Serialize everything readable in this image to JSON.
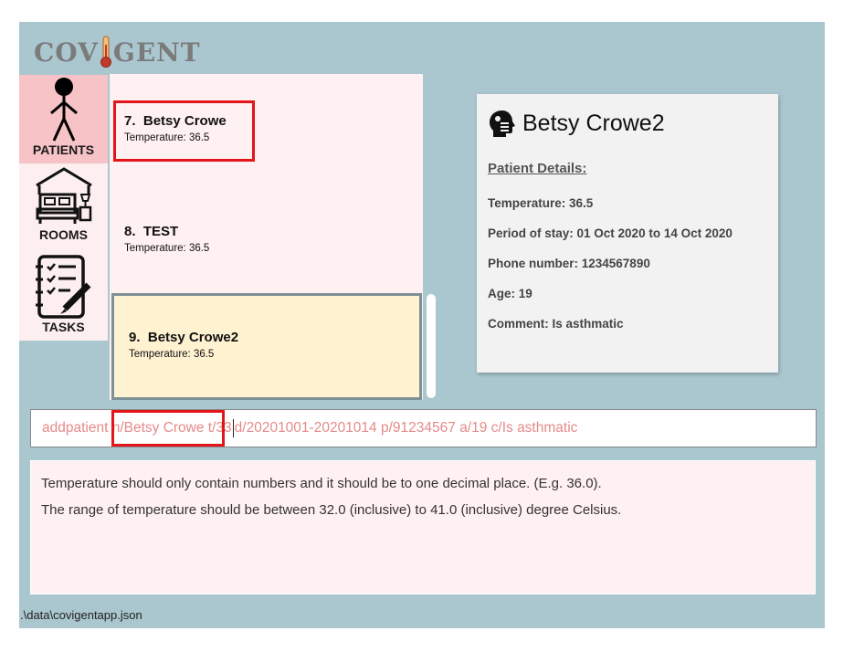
{
  "app": {
    "logo_text_left": "COV",
    "logo_text_right": "GENT"
  },
  "nav": [
    {
      "label": "PATIENTS",
      "icon": "person-icon",
      "active": true
    },
    {
      "label": "ROOMS",
      "icon": "bed-room-icon",
      "active": false
    },
    {
      "label": "TASKS",
      "icon": "checklist-icon",
      "active": false
    }
  ],
  "patients": [
    {
      "index": "7.",
      "name": "Betsy Crowe",
      "temperature": "Temperature: 36.5"
    },
    {
      "index": "8.",
      "name": "TEST",
      "temperature": "Temperature: 36.5"
    },
    {
      "index": "9.",
      "name": "Betsy Crowe2",
      "temperature": "Temperature: 36.5",
      "selected": true
    }
  ],
  "detail": {
    "name": "Betsy Crowe2",
    "icon": "patient-head-icon",
    "section": "Patient Details:",
    "temperature": "Temperature: 36.5",
    "period": "Period of stay: 01 Oct 2020 to 14 Oct 2020",
    "phone": "Phone number: 1234567890",
    "age": "Age: 19",
    "comment": "Comment: Is asthmatic"
  },
  "command": {
    "before_caret": "addpatient n/Betsy Crowe t/33",
    "after_caret": "d/20201001-20201014 p/91234567 a/19 c/Is asthmatic"
  },
  "result": {
    "line1": "Temperature should only contain numbers and it should be to one decimal place. (E.g. 36.0).",
    "line2": "The range of temperature should be between 32.0 (inclusive) to 41.0 (inclusive) degree Celsius."
  },
  "status": {
    "path": ".\\data\\covigentapp.json"
  },
  "colors": {
    "highlight": "#e3141a",
    "background": "#aac6cf",
    "selected_card": "#fff2d1",
    "command_text": "#e58a8a"
  }
}
